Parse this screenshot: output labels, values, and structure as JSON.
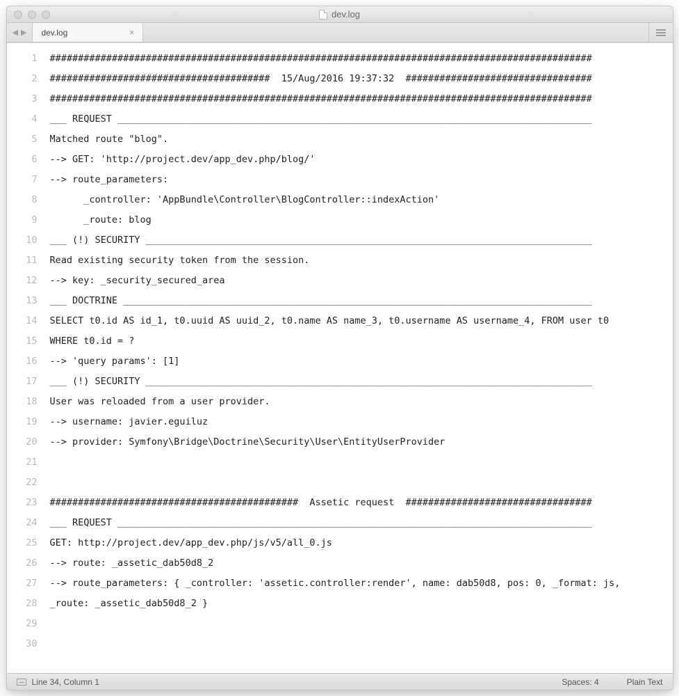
{
  "window": {
    "title": "dev.log"
  },
  "tabs": [
    {
      "label": "dev.log",
      "active": true
    }
  ],
  "gutter": [
    "1",
    "2",
    "3",
    "4",
    "5",
    "6",
    "7",
    "8",
    "9",
    "10",
    "11",
    "12",
    "13",
    "14",
    "15",
    "16",
    "17",
    "18",
    "19",
    "20",
    "21",
    "22",
    "23",
    "24",
    "25",
    "26",
    "27",
    "28",
    "29",
    "30"
  ],
  "lines": [
    "################################################################################################",
    "#######################################  15/Aug/2016 19:37:32  #################################",
    "################################################################################################",
    "___ REQUEST ____________________________________________________________________________________",
    "Matched route \"blog\".",
    "--> GET: 'http://project.dev/app_dev.php/blog/'",
    "--> route_parameters:",
    "      _controller: 'AppBundle\\Controller\\BlogController::indexAction'",
    "      _route: blog",
    "___ (!) SECURITY _______________________________________________________________________________",
    "Read existing security token from the session.",
    "--> key: _security_secured_area",
    "___ DOCTRINE ___________________________________________________________________________________",
    "SELECT t0.id AS id_1, t0.uuid AS uuid_2, t0.name AS name_3, t0.username AS username_4, FROM user t0",
    "WHERE t0.id = ?",
    "--> 'query params': [1]",
    "___ (!) SECURITY _______________________________________________________________________________",
    "User was reloaded from a user provider.",
    "--> username: javier.eguiluz",
    "--> provider: Symfony\\Bridge\\Doctrine\\Security\\User\\EntityUserProvider",
    "",
    "",
    "############################################  Assetic request  #################################",
    "___ REQUEST ____________________________________________________________________________________",
    "GET: http://project.dev/app_dev.php/js/v5/all_0.js",
    "--> route: _assetic_dab50d8_2",
    "--> route_parameters: { _controller: 'assetic.controller:render', name: dab50d8, pos: 0, _format: js,",
    "_route: _assetic_dab50d8_2 }",
    "",
    ""
  ],
  "statusbar": {
    "position": "Line 34, Column 1",
    "spaces": "Spaces: 4",
    "syntax": "Plain Text"
  }
}
